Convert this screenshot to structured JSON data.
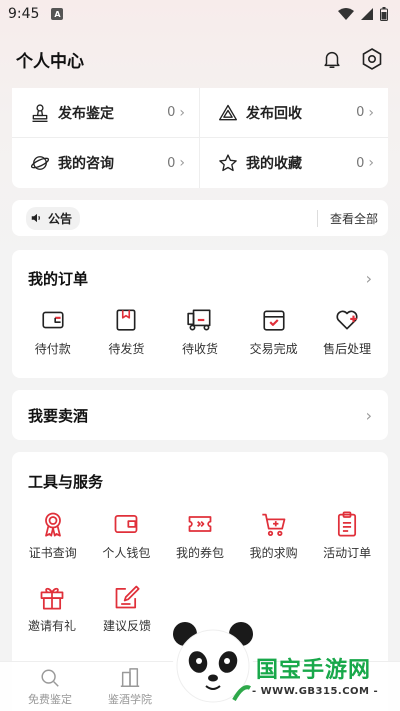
{
  "status_bar": {
    "time": "9:45",
    "badge": "A"
  },
  "header": {
    "title": "个人中心",
    "icons": [
      "bell-icon",
      "settings-icon"
    ]
  },
  "quick": {
    "items": [
      {
        "label": "发布鉴定",
        "count": "0",
        "icon": "stamp-icon"
      },
      {
        "label": "发布回收",
        "count": "0",
        "icon": "recycle-icon"
      },
      {
        "label": "我的咨询",
        "count": "0",
        "icon": "planet-icon"
      },
      {
        "label": "我的收藏",
        "count": "0",
        "icon": "star-icon"
      }
    ]
  },
  "notice": {
    "tag": "公告",
    "more": "查看全部"
  },
  "orders": {
    "title": "我的订单",
    "items": [
      {
        "label": "待付款",
        "icon": "wallet-icon"
      },
      {
        "label": "待发货",
        "icon": "package-icon"
      },
      {
        "label": "待收货",
        "icon": "truck-icon"
      },
      {
        "label": "交易完成",
        "icon": "box-check-icon"
      },
      {
        "label": "售后处理",
        "icon": "heart-plus-icon"
      }
    ]
  },
  "sell": {
    "title": "我要卖酒"
  },
  "tools": {
    "title": "工具与服务",
    "row1": [
      {
        "label": "证书查询",
        "icon": "certificate-icon"
      },
      {
        "label": "个人钱包",
        "icon": "wallet-icon"
      },
      {
        "label": "我的券包",
        "icon": "coupon-icon"
      },
      {
        "label": "我的求购",
        "icon": "cart-plus-icon"
      },
      {
        "label": "活动订单",
        "icon": "clipboard-icon"
      }
    ],
    "row2": [
      {
        "label": "邀请有礼",
        "icon": "gift-icon"
      },
      {
        "label": "建议反馈",
        "icon": "edit-icon"
      }
    ]
  },
  "bottom_nav": [
    {
      "label": "免费鉴定",
      "icon": "search-icon"
    },
    {
      "label": "鉴酒学院",
      "icon": "building-icon"
    }
  ],
  "watermark": {
    "text": "国宝手游网",
    "url": "- WWW.GB315.COM -"
  },
  "colors": {
    "accent": "#e0303a",
    "watermark_green": "#18a84a"
  }
}
